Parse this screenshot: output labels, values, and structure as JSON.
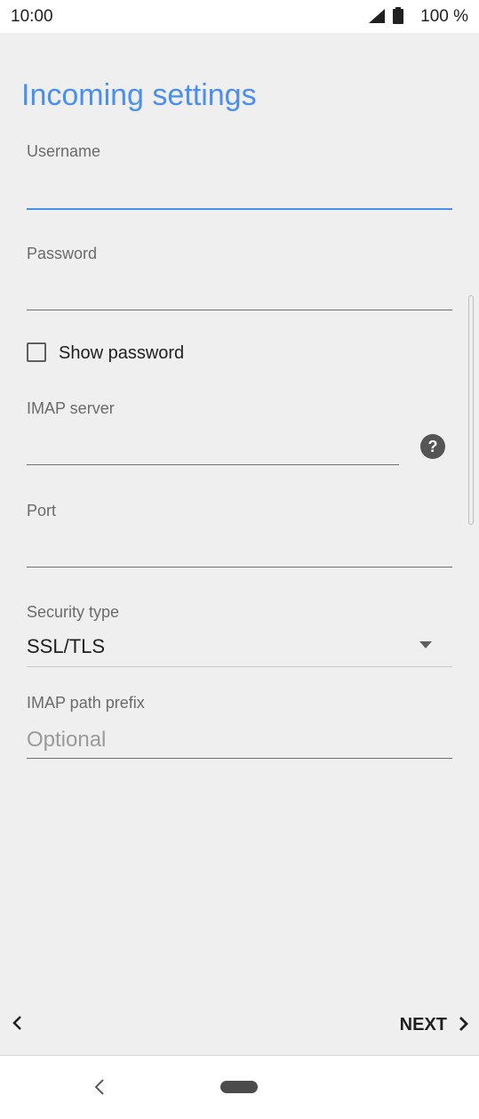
{
  "status_bar": {
    "time": "10:00",
    "battery": "100 %"
  },
  "page": {
    "title": "Incoming settings"
  },
  "form": {
    "username": {
      "label": "Username",
      "value": ""
    },
    "password": {
      "label": "Password",
      "value": ""
    },
    "show_password": {
      "label": "Show password",
      "checked": false
    },
    "imap_server": {
      "label": "IMAP server",
      "value": ""
    },
    "port": {
      "label": "Port",
      "value": ""
    },
    "security_type": {
      "label": "Security type",
      "value": "SSL/TLS"
    },
    "imap_path_prefix": {
      "label": "IMAP path prefix",
      "placeholder": "Optional",
      "value": ""
    }
  },
  "actions": {
    "next_label": "NEXT"
  },
  "icons": {
    "signal": "signal-icon",
    "battery": "battery-icon",
    "help": "help-icon",
    "dropdown": "chevron-down-icon",
    "back": "chevron-left-icon",
    "next": "chevron-right-icon",
    "nav_back": "nav-back-icon",
    "nav_home": "home-pill-icon"
  },
  "colors": {
    "accent": "#4a8ff0",
    "background": "#efefef"
  }
}
